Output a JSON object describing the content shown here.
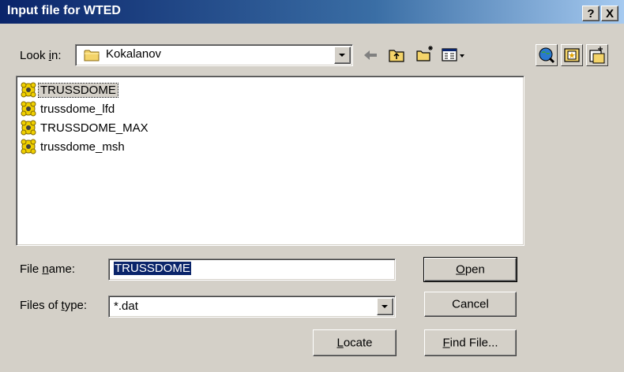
{
  "window": {
    "title": "Input file for WTED",
    "help_label": "?",
    "close_label": "X"
  },
  "look_in": {
    "label_pre": "Look ",
    "label_ul": "i",
    "label_post": "n:",
    "value": "Kokalanov"
  },
  "toolbar": {
    "icons": [
      "back-arrow-icon",
      "up-one-level-icon",
      "create-new-folder-icon",
      "view-menu-icon"
    ]
  },
  "right_toolbar": {
    "icons": [
      "network-search-icon",
      "favorites-folder-icon",
      "options-icon"
    ]
  },
  "files": [
    {
      "name": "TRUSSDOME",
      "selected": true
    },
    {
      "name": "trussdome_lfd",
      "selected": false
    },
    {
      "name": "TRUSSDOME_MAX",
      "selected": false
    },
    {
      "name": "trussdome_msh",
      "selected": false
    }
  ],
  "file_name": {
    "label_pre": "File ",
    "label_ul": "n",
    "label_post": "ame:",
    "value": "TRUSSDOME"
  },
  "file_type": {
    "label_pre": "Files of ",
    "label_ul": "t",
    "label_post": "ype:",
    "value": "*.dat"
  },
  "buttons": {
    "open_ul": "O",
    "open_rest": "pen",
    "cancel": "Cancel",
    "locate_ul": "L",
    "locate_rest": "ocate",
    "find_ul": "F",
    "find_rest": "ind File..."
  },
  "colors": {
    "title_bar": "#0a246a",
    "dialog_bg": "#d4d0c8",
    "selection": "#0a246a",
    "file_icon": "#f0d000"
  }
}
